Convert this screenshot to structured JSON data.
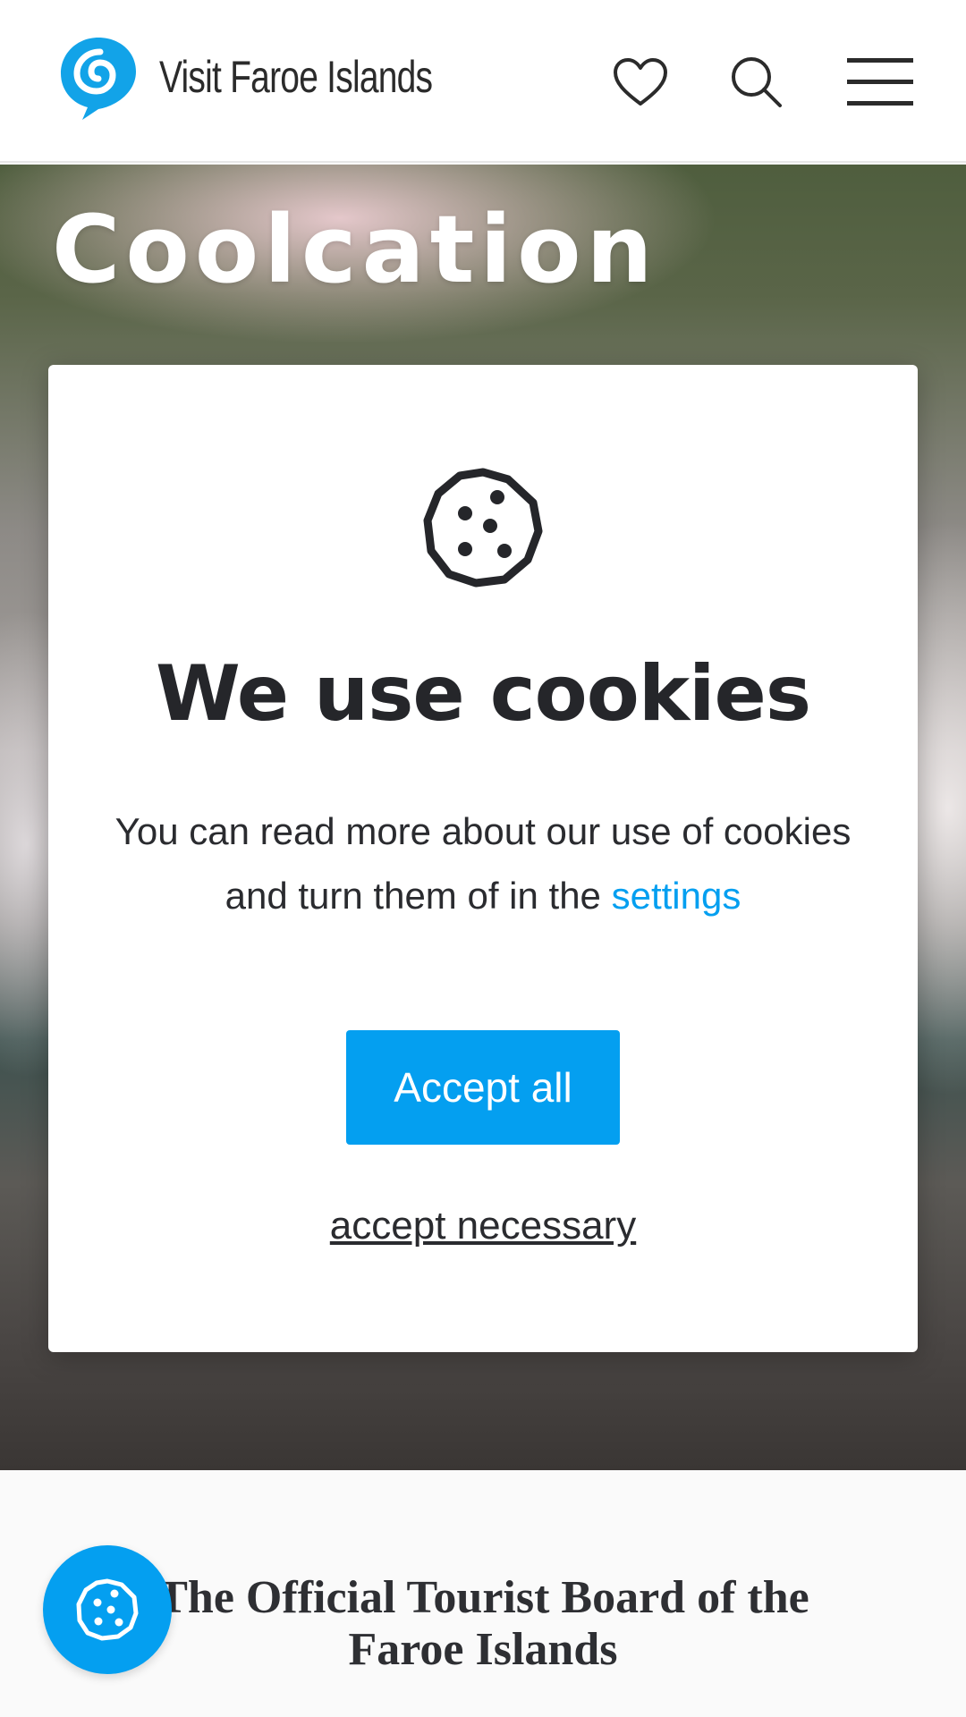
{
  "header": {
    "logo_text": "Visit Faroe Islands",
    "icons": [
      "heart-icon",
      "search-icon",
      "hamburger-menu-icon"
    ]
  },
  "hero": {
    "title": "Coolcation"
  },
  "cookie_modal": {
    "icon": "cookie-icon",
    "title": "We use cookies",
    "text": "You can read more about our use of cookies and turn them of in the",
    "settings_link": "settings",
    "accept_all": "Accept all",
    "accept_necessary": "accept necessary"
  },
  "content": {
    "board_title": "The Official Tourist Board of the Faroe Islands"
  },
  "cookie_settings_button": {
    "icon": "cookie-icon"
  },
  "colors": {
    "accent": "#049ff0",
    "text": "#25262a",
    "modal_bg": "#ffffff"
  }
}
